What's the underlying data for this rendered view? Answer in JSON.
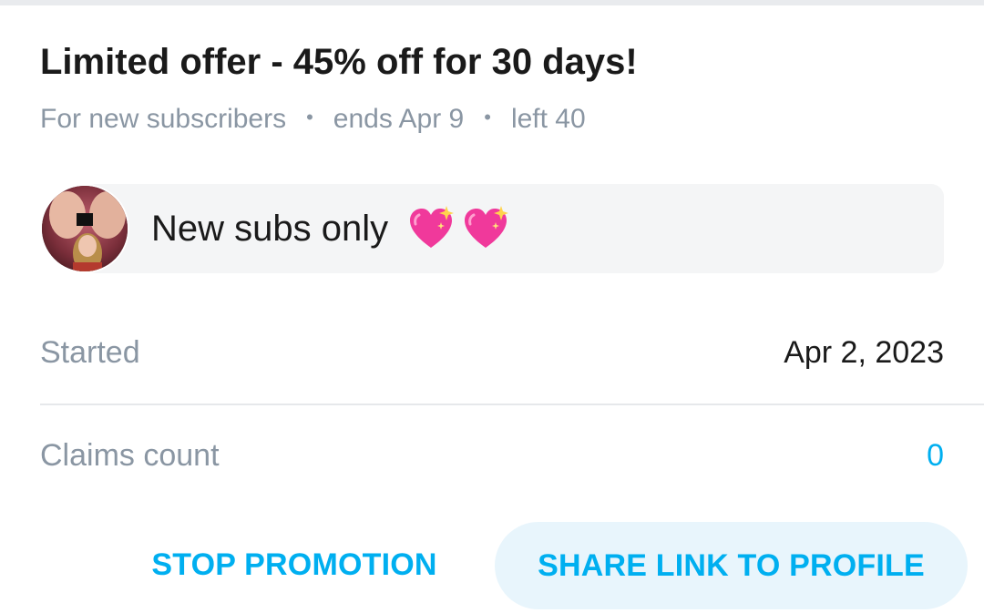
{
  "offer": {
    "title": "Limited offer - 45% off for 30 days!",
    "audience": "For new subscribers",
    "ends": "ends Apr 9",
    "left": "left 40",
    "separator": "•"
  },
  "message": {
    "text": "New subs only",
    "emoji_icons": [
      "sparkling-heart-icon",
      "sparkling-heart-icon"
    ]
  },
  "details": {
    "started_label": "Started",
    "started_value": "Apr 2, 2023",
    "claims_label": "Claims count",
    "claims_value": "0"
  },
  "actions": {
    "stop_label": "STOP PROMOTION",
    "share_label": "SHARE LINK TO PROFILE"
  },
  "colors": {
    "accent": "#00aff0",
    "muted_text": "#8a96a3",
    "heart": "#f0399b"
  }
}
